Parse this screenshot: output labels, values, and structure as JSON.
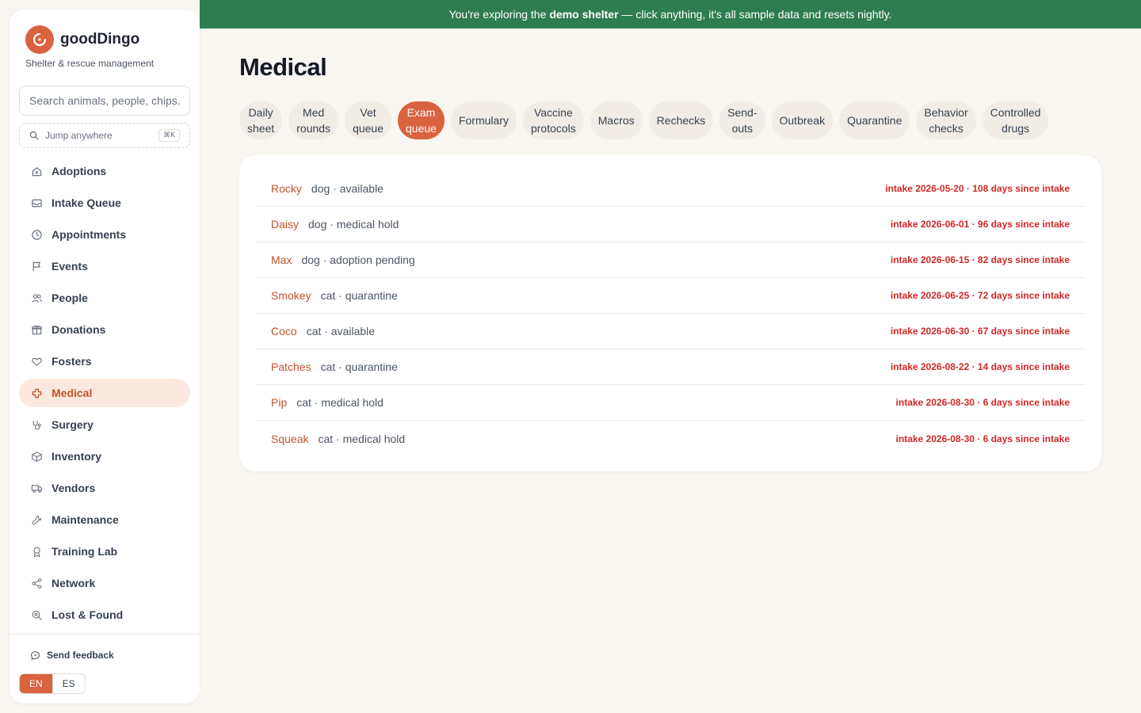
{
  "brand": {
    "name": "goodDingo",
    "tagline": "Shelter & rescue management"
  },
  "search": {
    "placeholder": "Search animals, people, chips..."
  },
  "jump": {
    "label": "Jump anywhere",
    "shortcut": "⌘K"
  },
  "sidebar": {
    "items": [
      {
        "label": "Adoptions",
        "icon": "house-icon"
      },
      {
        "label": "Intake Queue",
        "icon": "inbox-icon"
      },
      {
        "label": "Appointments",
        "icon": "clock-icon"
      },
      {
        "label": "Events",
        "icon": "flag-icon"
      },
      {
        "label": "People",
        "icon": "people-icon"
      },
      {
        "label": "Donations",
        "icon": "gift-icon"
      },
      {
        "label": "Fosters",
        "icon": "heart-icon"
      },
      {
        "label": "Medical",
        "icon": "medical-cross-icon",
        "active": true
      },
      {
        "label": "Surgery",
        "icon": "stethoscope-icon"
      },
      {
        "label": "Inventory",
        "icon": "box-icon"
      },
      {
        "label": "Vendors",
        "icon": "truck-icon"
      },
      {
        "label": "Maintenance",
        "icon": "wrench-icon"
      },
      {
        "label": "Training Lab",
        "icon": "award-icon"
      },
      {
        "label": "Network",
        "icon": "share-icon"
      },
      {
        "label": "Lost & Found",
        "icon": "search-zoom-icon"
      }
    ],
    "feedback_label": "Send feedback",
    "languages": [
      "EN",
      "ES"
    ],
    "active_language": "EN"
  },
  "banner": {
    "before": "You're exploring the",
    "bold": "demo shelter",
    "after": "— click anything, it's all sample data and resets nightly."
  },
  "page": {
    "title": "Medical"
  },
  "tabs": [
    {
      "line1": "Daily",
      "line2": "sheet"
    },
    {
      "line1": "Med",
      "line2": "rounds"
    },
    {
      "line1": "Vet",
      "line2": "queue"
    },
    {
      "line1": "Exam",
      "line2": "queue",
      "active": true
    },
    {
      "line1": "Formulary",
      "line2": ""
    },
    {
      "line1": "Vaccine",
      "line2": "protocols"
    },
    {
      "line1": "Macros",
      "line2": ""
    },
    {
      "line1": "Rechecks",
      "line2": ""
    },
    {
      "line1": "Send-",
      "line2": "outs"
    },
    {
      "line1": "Outbreak",
      "line2": ""
    },
    {
      "line1": "Quarantine",
      "line2": ""
    },
    {
      "line1": "Behavior",
      "line2": "checks"
    },
    {
      "line1": "Controlled",
      "line2": "drugs"
    }
  ],
  "exam_queue": [
    {
      "name": "Rocky",
      "meta": "dog · available",
      "intake": "intake 2026-05-20 · 108 days since intake"
    },
    {
      "name": "Daisy",
      "meta": "dog · medical hold",
      "intake": "intake 2026-06-01 · 96 days since intake"
    },
    {
      "name": "Max",
      "meta": "dog · adoption pending",
      "intake": "intake 2026-06-15 · 82 days since intake"
    },
    {
      "name": "Smokey",
      "meta": "cat · quarantine",
      "intake": "intake 2026-06-25 · 72 days since intake"
    },
    {
      "name": "Coco",
      "meta": "cat · available",
      "intake": "intake 2026-06-30 · 67 days since intake"
    },
    {
      "name": "Patches",
      "meta": "cat · quarantine",
      "intake": "intake 2026-08-22 · 14 days since intake"
    },
    {
      "name": "Pip",
      "meta": "cat · medical hold",
      "intake": "intake 2026-08-30 · 6 days since intake"
    },
    {
      "name": "Squeak",
      "meta": "cat · medical hold",
      "intake": "intake 2026-08-30 · 6 days since intake"
    }
  ],
  "colors": {
    "accent": "#d9623f",
    "banner": "#2e7d52",
    "alert": "#d12727"
  }
}
